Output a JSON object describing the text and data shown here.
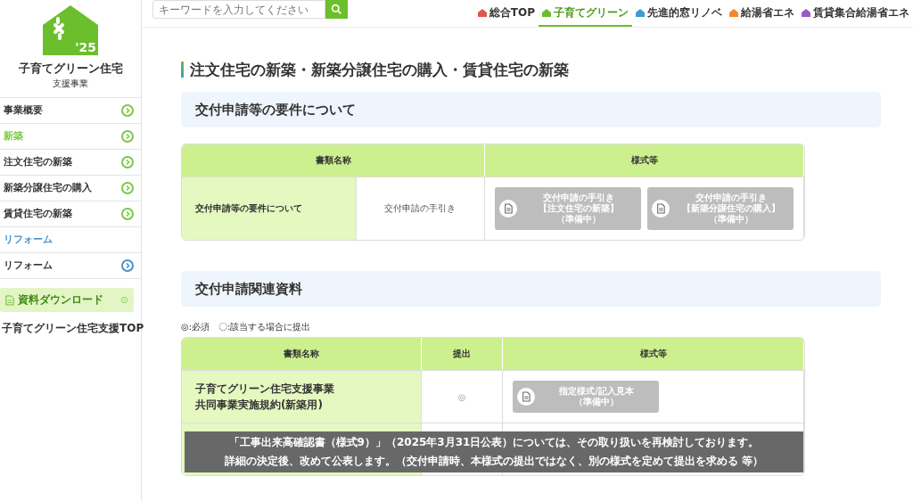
{
  "logo": {
    "year": "'25",
    "title": "子育てグリーン住宅",
    "subtitle": "支援事業"
  },
  "sidebar": {
    "items": [
      {
        "label": "事業概要",
        "kind": "link",
        "color": "#7ac943"
      },
      {
        "label": "新築",
        "kind": "section",
        "color": "#7ac943"
      },
      {
        "label": "注文住宅の新築",
        "kind": "link",
        "color": "#7ac943"
      },
      {
        "label": "新築分譲住宅の購入",
        "kind": "link",
        "color": "#7ac943"
      },
      {
        "label": "賃貸住宅の新築",
        "kind": "link",
        "color": "#7ac943"
      },
      {
        "label": "リフォーム",
        "kind": "heading",
        "color": "#4a90c8"
      },
      {
        "label": "リフォーム",
        "kind": "link",
        "color": "#4a90c8"
      }
    ],
    "download": "資料ダウンロード",
    "top_link": "子育てグリーン住宅支援TOP"
  },
  "search": {
    "placeholder": "キーワードを入力してください"
  },
  "nav": [
    {
      "label": "総合TOP",
      "color": "#e0564a",
      "selected": false
    },
    {
      "label": "子育てグリーン",
      "color": "#6cbf2c",
      "selected": true
    },
    {
      "label": "先進的窓リノベ",
      "color": "#3d9ad6",
      "selected": false
    },
    {
      "label": "給湯省エネ",
      "color": "#f08a2c",
      "selected": false
    },
    {
      "label": "賃貸集合給湯省エネ",
      "color": "#9a5bc4",
      "selected": false
    }
  ],
  "page_title": "注文住宅の新築・新築分譲住宅の購入・賃貸住宅の新築",
  "section1": {
    "heading": "交付申請等の要件について",
    "columns": [
      "書類名称",
      "様式等"
    ],
    "rows": [
      {
        "name": "交付申請等の要件について",
        "detail": "交付申請の手引き",
        "buttons": [
          {
            "lines": [
              "交付申請の手引き",
              "【注文住宅の新築】",
              "（準備中）"
            ],
            "disabled": true
          },
          {
            "lines": [
              "交付申請の手引き",
              "【新築分譲住宅の購入】",
              "（準備中）"
            ],
            "disabled": true
          }
        ]
      }
    ]
  },
  "section2": {
    "heading": "交付申請関連資料",
    "legend": "◎:必須　〇:該当する場合に提出",
    "columns": [
      "書類名称",
      "提出",
      "様式等"
    ],
    "rows": [
      {
        "name_lines": [
          "子育てグリーン住宅支援事業",
          "共同事業実施規約(新築用)"
        ],
        "submit": "◎",
        "buttons": [
          {
            "lines": [
              "指定様式/記入見本",
              "（準備中）"
            ],
            "disabled": true
          }
        ]
      }
    ]
  },
  "notice": {
    "lines": [
      "「工事出来高確認書（様式9）」（2025年3月31日公表）については、その取り扱いを再検討しております。",
      "詳細の決定後、改めて公表します。（交付申請時、本様式の提出ではなく、別の様式を定めて提出を求める 等）"
    ]
  }
}
